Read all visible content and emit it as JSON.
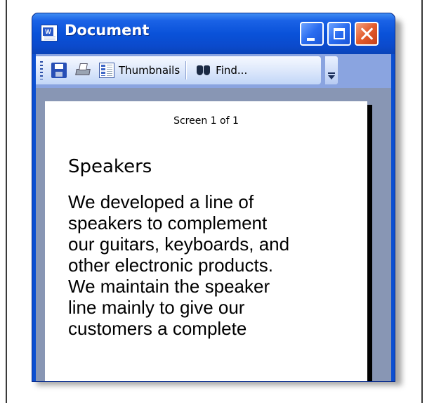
{
  "window": {
    "title": "Document",
    "buttons": {
      "minimize": "",
      "maximize": "",
      "close": ""
    }
  },
  "toolbar": {
    "icons": [
      "save-icon",
      "print-icon",
      "thumbnails-icon",
      "find-icon"
    ],
    "thumbnails_label": "Thumbnails",
    "find_label": "Find..."
  },
  "page": {
    "screen_indicator": "Screen 1 of 1",
    "heading": "Speakers",
    "body_lines": [
      "We developed a line of",
      "speakers to complement",
      "our guitars, keyboards, and",
      "other electronic products.",
      "We maintain the speaker",
      "line mainly to give our",
      "customers a complete"
    ]
  },
  "colors": {
    "titlebar": "#0a52d9",
    "close_button": "#e35b2c",
    "toolbar": "#dde8fb",
    "content_background": "#8896b4",
    "page_background": "#ffffff"
  }
}
